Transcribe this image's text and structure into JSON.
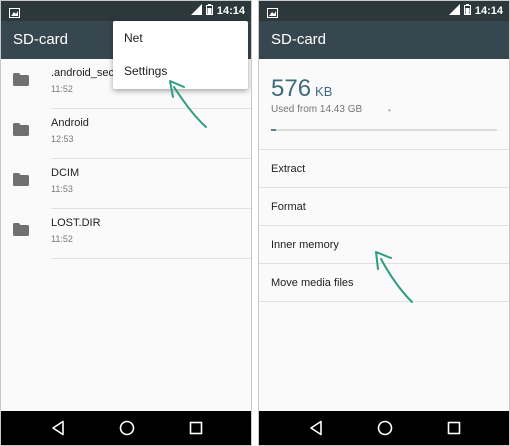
{
  "status_bar": {
    "time": "14:14"
  },
  "left_screen": {
    "title": "SD-card",
    "files": [
      {
        "name": ".android_secure",
        "time": "11:52"
      },
      {
        "name": "Android",
        "time": "12:53"
      },
      {
        "name": "DCIM",
        "time": "11:53"
      },
      {
        "name": "LOST.DIR",
        "time": "11:52"
      }
    ],
    "menu": [
      "Net",
      "Settings"
    ]
  },
  "right_screen": {
    "title": "SD-card",
    "storage_value": "576",
    "storage_unit": "KB",
    "storage_sub": "Used from 14.43 GB",
    "storage_dot": "•",
    "storage_used_fraction": 0.02,
    "options": [
      "Extract",
      "Format",
      "Inner memory",
      "Move media files"
    ]
  },
  "colors": {
    "app_bar": "#37474f",
    "status_bar": "#2d383c",
    "accent_text": "#3e6b7c",
    "arrow": "#2f9c82"
  },
  "icons": [
    "image-notification-icon",
    "signal-icon",
    "battery-icon",
    "folder-icon",
    "back-icon",
    "home-icon",
    "recents-icon"
  ]
}
